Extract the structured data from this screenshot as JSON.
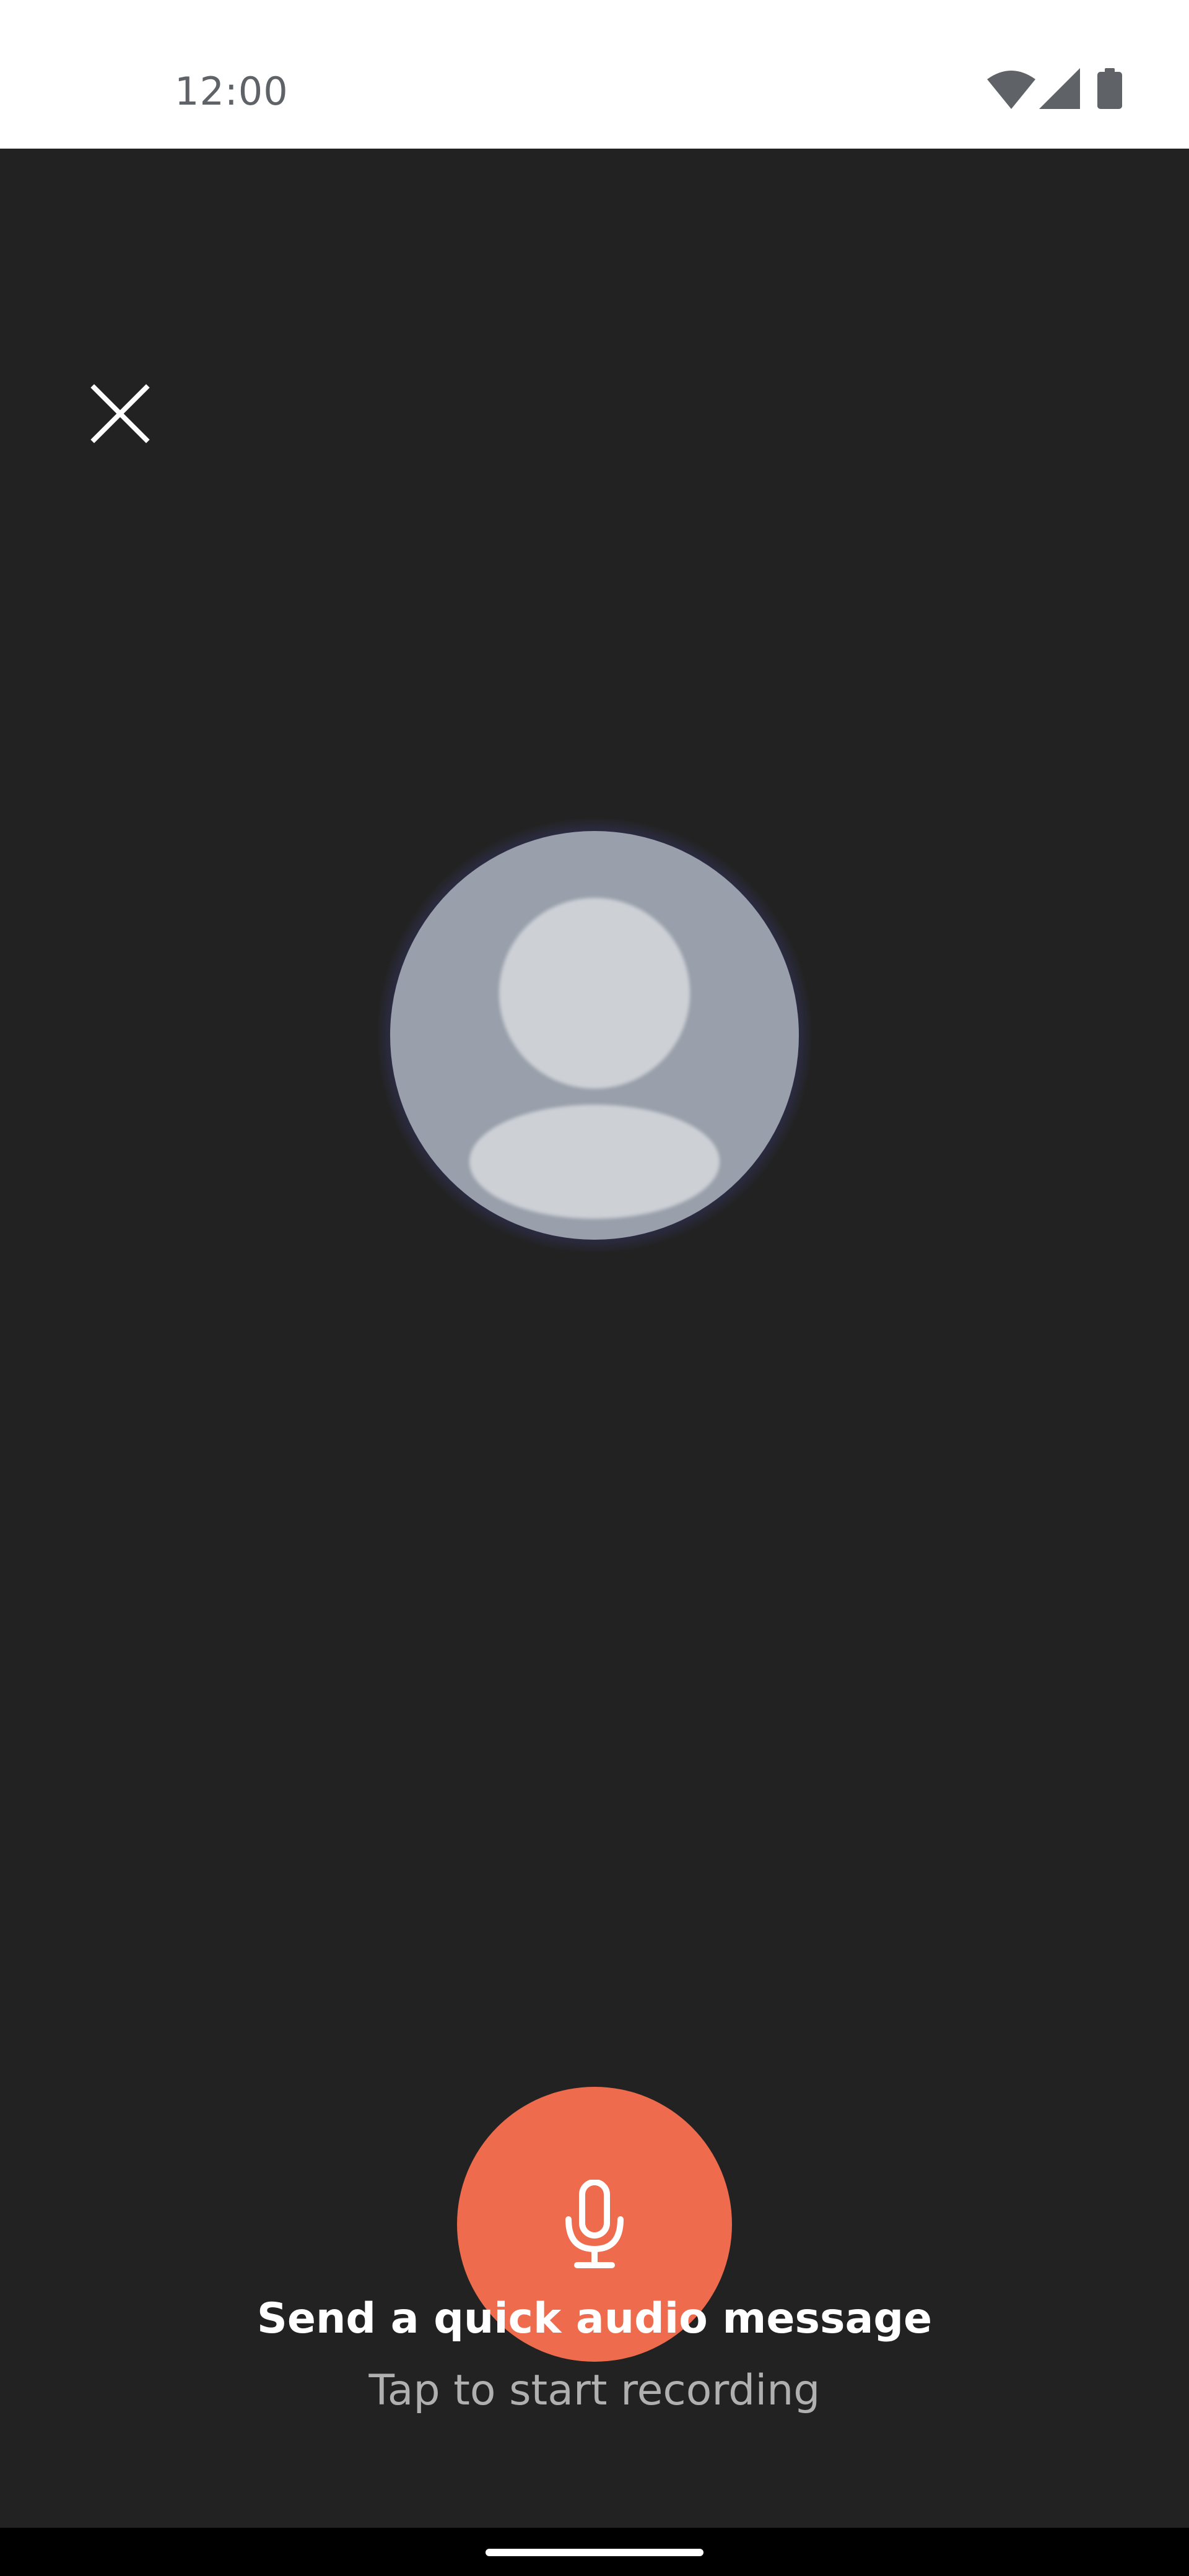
{
  "status_bar": {
    "time": "12:00",
    "icons": [
      "wifi-icon",
      "signal-icon",
      "battery-icon"
    ]
  },
  "toolbar": {
    "close_icon": "close-icon"
  },
  "avatar": {
    "icon": "person-placeholder-icon"
  },
  "record": {
    "icon": "microphone-icon"
  },
  "prompt": {
    "title": "Send a quick audio message",
    "subtitle": "Tap to start recording"
  },
  "colors": {
    "background": "#222222",
    "accent": "#ee6c4d",
    "glow": "#3a3791",
    "avatar": "#9aa0ab"
  }
}
